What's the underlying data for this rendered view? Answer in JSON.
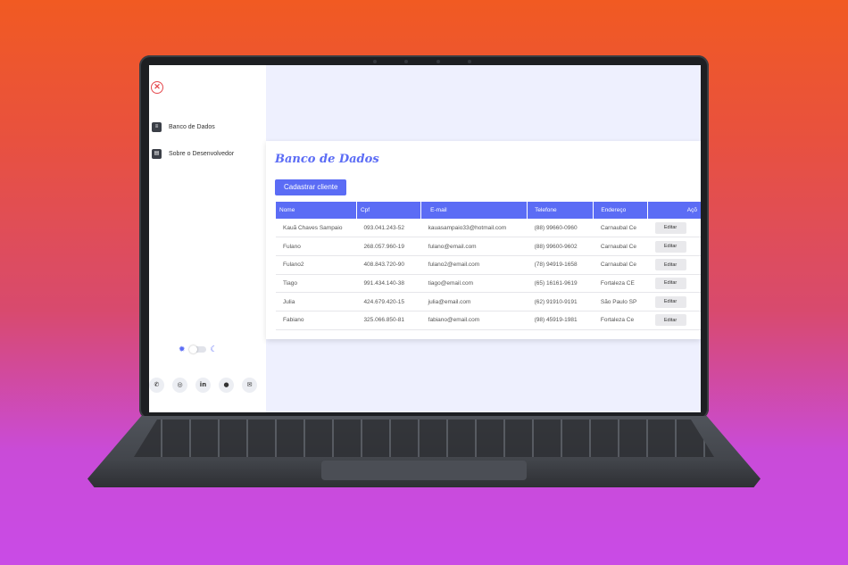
{
  "sidebar": {
    "close_icon": "close-icon",
    "items": [
      {
        "label": "Banco de Dados",
        "icon": "database-icon"
      },
      {
        "label": "Sobre o Desenvolvedor",
        "icon": "id-card-icon"
      }
    ],
    "theme_toggle": {
      "sun_icon": "sun-icon",
      "moon_icon": "moon-icon",
      "dark_mode": false
    },
    "socials": [
      "whatsapp-icon",
      "instagram-icon",
      "linkedin-icon",
      "github-icon",
      "email-icon"
    ]
  },
  "main": {
    "title": "Banco de Dados",
    "add_button": "Cadastrar cliente",
    "table": {
      "headers": [
        "Nome",
        "Cpf",
        "E-mail",
        "Telefone",
        "Endereço",
        "Açõ"
      ],
      "edit_label": "Editar",
      "rows": [
        {
          "nome": "Kauã Chaves Sampaio",
          "cpf": "093.041.243-52",
          "email": "kauasampaio33@hotmail.com",
          "telefone": "(88) 99660-0960",
          "endereco": "Carnaubal Ce"
        },
        {
          "nome": "Fulano",
          "cpf": "268.057.960-19",
          "email": "fulano@email.com",
          "telefone": "(88) 99600-9602",
          "endereco": "Carnaubal Ce"
        },
        {
          "nome": "Fulano2",
          "cpf": "408.843.720-90",
          "email": "fulano2@email.com",
          "telefone": "(78) 94919-1658",
          "endereco": "Carnaubal Ce"
        },
        {
          "nome": "Tiago",
          "cpf": "991.434.140-38",
          "email": "tiago@email.com",
          "telefone": "(65) 16161-9619",
          "endereco": "Fortaleza CE"
        },
        {
          "nome": "Julia",
          "cpf": "424.679.420-15",
          "email": "julia@email.com",
          "telefone": "(62) 91910-9191",
          "endereco": "São Paulo SP"
        },
        {
          "nome": "Fabiano",
          "cpf": "325.066.850-81",
          "email": "fabiano@email.com",
          "telefone": "(98) 45919-1981",
          "endereco": "Fortaleza Ce"
        }
      ]
    }
  },
  "colors": {
    "accent": "#5b6cf5",
    "close": "#e5484d",
    "screen_bg": "#eef0fe"
  }
}
